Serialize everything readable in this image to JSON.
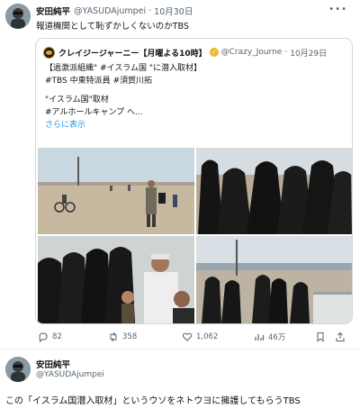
{
  "post": {
    "author_name": "安田純平",
    "author_handle": "@YASUDAjumpei",
    "separator": "·",
    "date": "10月30日",
    "more_icon": "more-horizontal-icon",
    "text": "報道機関として恥ずかしくないのかTBS",
    "quote": {
      "author_name": "クレイジージャーニー【月曜よる10時】",
      "author_handle": "@Crazy_Journe",
      "separator": "·",
      "date": "10月29日",
      "lines": [
        "【過激派組織\" #イスラム国 \"に潜入取材】",
        "#TBS 中東特派員 #須賀川拓",
        "\"イスラム国\"取材",
        "#アルホールキャンプ へ..."
      ],
      "show_more": "さらに表示",
      "photos": [
        "desert-camp-photo",
        "women-in-black-photo",
        "crowd-photo",
        "camp-fence-photo"
      ]
    },
    "actions": {
      "replies": "82",
      "reposts": "358",
      "likes": "1,062",
      "views": "46万"
    },
    "colors": {
      "link": "#1d9bf0",
      "secondary": "#536471",
      "border": "#cfd9de"
    }
  },
  "reply": {
    "author_name": "安田純平",
    "author_handle": "@YASUDAjumpei",
    "text": "この「イスラム国潜入取材」というウソをネトウヨに擁護してもらうTBS"
  }
}
